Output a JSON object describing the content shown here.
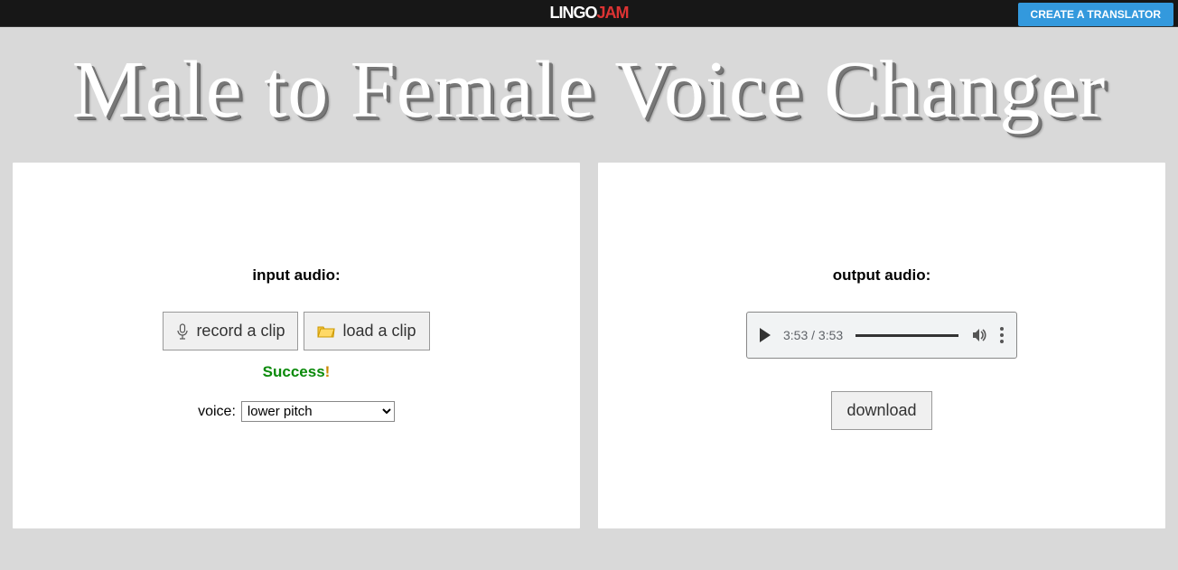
{
  "header": {
    "logo_lingo": "LINGO",
    "logo_jam": "JAM",
    "create_label": "CREATE A TRANSLATOR"
  },
  "title": "Male to Female Voice Changer",
  "input_panel": {
    "heading": "input audio:",
    "record_label": "record a clip",
    "load_label": "load a clip",
    "status_text": "Success",
    "status_bang": "!",
    "voice_label": "voice:",
    "voice_selected": "lower pitch"
  },
  "output_panel": {
    "heading": "output audio:",
    "time_display": "3:53 / 3:53",
    "download_label": "download"
  }
}
